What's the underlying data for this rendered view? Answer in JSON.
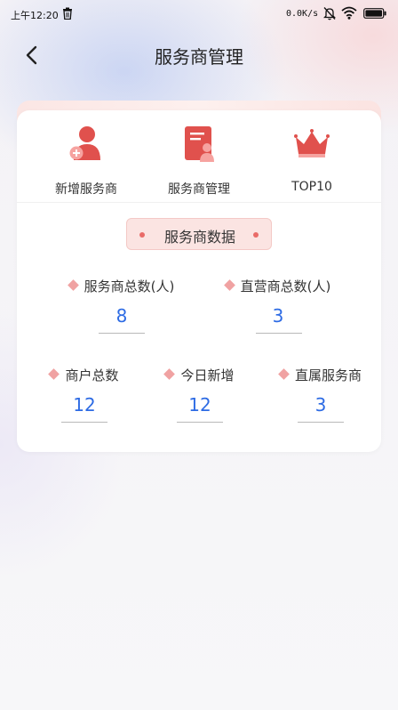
{
  "status_bar": {
    "time": "上午12:20",
    "net_speed": "0.0K/s",
    "icons": [
      "trash-icon",
      "bell-muted-icon",
      "wifi-icon",
      "battery-icon"
    ]
  },
  "nav": {
    "back_icon": "chevron-left-icon",
    "title": "服务商管理"
  },
  "quick_actions": [
    {
      "label": "新增服务商",
      "icon": "add-user-icon"
    },
    {
      "label": "服务商管理",
      "icon": "document-user-icon"
    },
    {
      "label": "TOP10",
      "icon": "crown-icon"
    }
  ],
  "section": {
    "title": "服务商数据"
  },
  "stats": {
    "total_providers": {
      "label": "服务商总数(人)",
      "value": "8"
    },
    "direct_providers": {
      "label": "直营商总数(人)",
      "value": "3"
    },
    "total_merchants": {
      "label": "商户总数",
      "value": "12"
    },
    "today_new": {
      "label": "今日新增",
      "value": "12"
    },
    "affiliated_providers": {
      "label": "直属服务商",
      "value": "3"
    }
  },
  "colors": {
    "accent": "#e0514d",
    "value_blue": "#2d6be4",
    "badge_bg": "#fbe4e2",
    "diamond": "#f0a2a2"
  }
}
